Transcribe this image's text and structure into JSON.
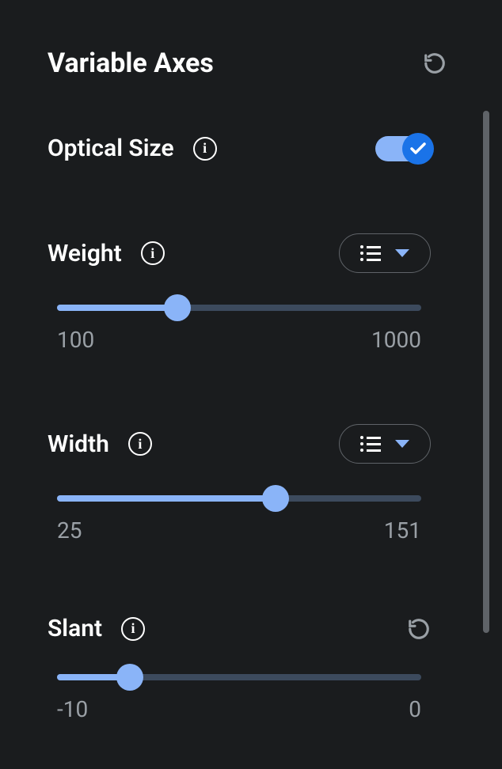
{
  "header": {
    "title": "Variable Axes"
  },
  "axes": {
    "optical_size": {
      "label": "Optical Size",
      "enabled": true
    },
    "weight": {
      "label": "Weight",
      "min": "100",
      "max": "1000",
      "fill_pct": 33
    },
    "width": {
      "label": "Width",
      "min": "25",
      "max": "151",
      "fill_pct": 60
    },
    "slant": {
      "label": "Slant",
      "min": "-10",
      "max": "0",
      "fill_pct": 20
    }
  }
}
